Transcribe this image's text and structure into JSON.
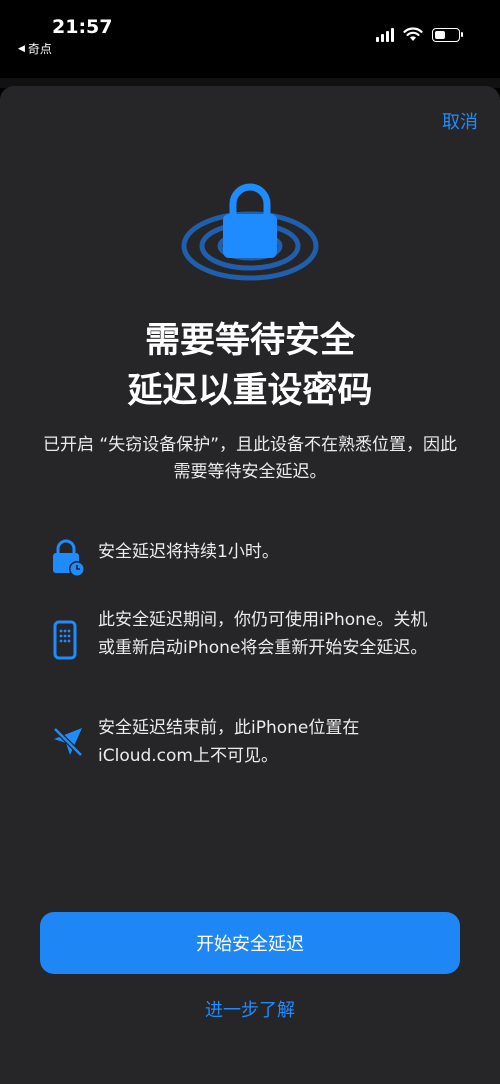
{
  "status_bar": {
    "time": "21:57",
    "back_app": "奇点"
  },
  "sheet": {
    "cancel_label": "取消",
    "title_line1": "需要等待安全",
    "title_line2": "延迟以重设密码",
    "subtitle": "已开启 “失窃设备保护”，且此设备不在熟悉位置，因此需要等待安全延迟。",
    "info_items": [
      {
        "icon": "lock-clock-icon",
        "text": "安全延迟将持续1小时。"
      },
      {
        "icon": "iphone-icon",
        "text": "此安全延迟期间，你仍可使用iPhone。关机或重新启动iPhone将会重新开始安全延迟。"
      },
      {
        "icon": "location-slash-icon",
        "text": "安全延迟结束前，此iPhone位置在iCloud.com上不可见。"
      }
    ],
    "primary_button": "开始安全延迟",
    "learn_more": "进一步了解"
  },
  "colors": {
    "accent": "#1e8cff",
    "button": "#1f86f5",
    "sheet_bg": "#262628"
  }
}
